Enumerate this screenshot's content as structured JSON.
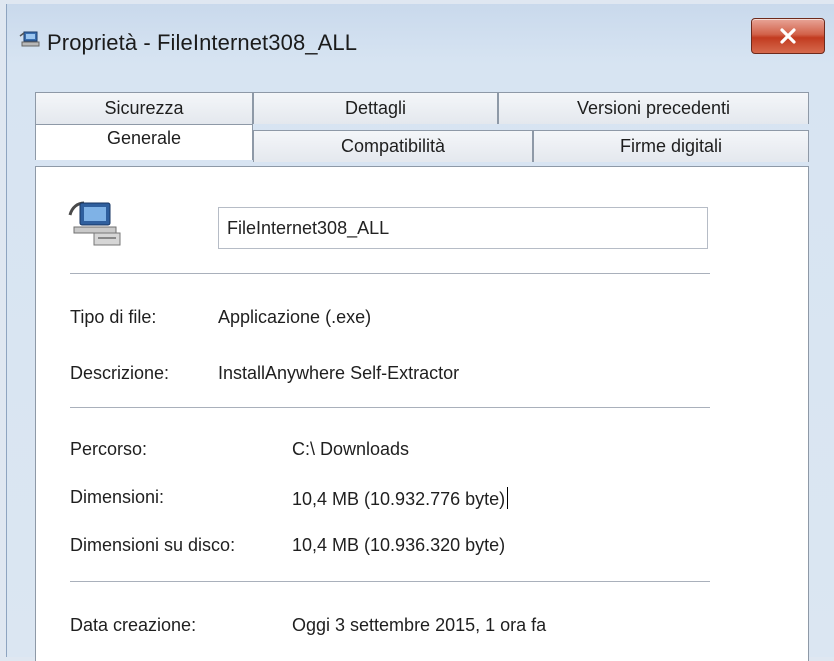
{
  "window": {
    "title": "Proprietà - FileInternet308_ALL",
    "close_icon": "close-icon"
  },
  "tabs_top": [
    {
      "label": "Sicurezza"
    },
    {
      "label": "Dettagli"
    },
    {
      "label": "Versioni precedenti"
    }
  ],
  "tabs_bottom": [
    {
      "label": "Generale",
      "active": true
    },
    {
      "label": "Compatibilità"
    },
    {
      "label": "Firme digitali"
    }
  ],
  "general": {
    "file_name": "FileInternet308_ALL",
    "file_type_label": "Tipo di file:",
    "file_type_value": "Applicazione (.exe)",
    "description_label": "Descrizione:",
    "description_value": "InstallAnywhere Self-Extractor",
    "path_label": "Percorso:",
    "path_value": "C:\\ Downloads",
    "size_label": "Dimensioni:",
    "size_value": "10,4 MB (10.932.776 byte)",
    "size_on_disk_label": "Dimensioni su disco:",
    "size_on_disk_value": "10,4 MB (10.936.320 byte)",
    "created_label": "Data creazione:",
    "created_value": "Oggi 3 settembre 2015, 1 ora fa"
  }
}
